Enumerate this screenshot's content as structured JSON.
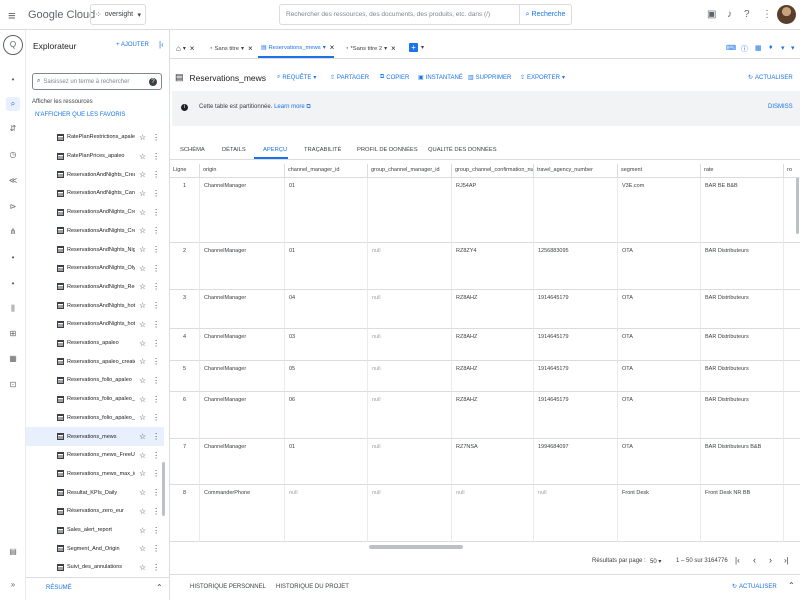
{
  "topbar": {
    "logo_google": "Google",
    "logo_cloud": "Cloud",
    "project": "oversight",
    "search_placeholder": "Rechercher des ressources, des documents, des produits, etc. dans (/)",
    "search_button": "Recherche"
  },
  "explorer": {
    "title": "Explorateur",
    "add_label": "+ AJOUTER",
    "search_placeholder": "Saisissez un terme à rechercher",
    "show_resources": "Afficher les ressources",
    "show_starred": "N'AFFICHER QUE LES FAVORIS",
    "items": [
      "RatePlanRestrictions_apaleo",
      "RatePlanPrices_apaleo",
      "ReservationAndNights_Creat...",
      "ReservationAndNights_Can...",
      "ReservationsAndNights_Crea...",
      "ReservationsAndNights_Crea...",
      "ReservationsAndNights_Night...",
      "ReservationsAndNights_Oly...",
      "ReservationsAndNights_Reg...",
      "ReservationsAndNights_hote...",
      "ReservationsAndNights_hote...",
      "Reservations_apaleo",
      "Reservations_apaleo_created...",
      "Reservations_folio_apaleo",
      "Reservations_folio_apaleo_A...",
      "Reservations_folio_apaleo_p...",
      "Reservations_mews",
      "Reservations_mews_FreeUpg...",
      "Reservations_mews_max_ins...",
      "Resultat_KPIs_Daily",
      "Réservations_zero_eur",
      "Sales_alert_report",
      "Segment_And_Origin",
      "Suivi_des_annulations"
    ],
    "selected_index": 16,
    "footer_label": "RÉSUMÉ"
  },
  "tabs": [
    {
      "label": ""
    },
    {
      "label": "Sans titre"
    },
    {
      "label": "Reservations_mews"
    },
    {
      "label": "*Sans titre 2"
    }
  ],
  "toolbar": {
    "title": "Reservations_mews",
    "query": "REQUÊTE",
    "share": "PARTAGER",
    "copy": "COPIER",
    "snapshot": "INSTANTANÉ",
    "delete": "SUPPRIMER",
    "export": "EXPORTER",
    "refresh": "ACTUALISER"
  },
  "info": {
    "text": "Cette table est partitionnée.",
    "link": "Learn more",
    "dismiss": "DISMISS"
  },
  "subtabs": [
    "SCHÉMA",
    "DÉTAILS",
    "APERÇU",
    "TRAÇABILITÉ",
    "PROFIL DE DONNÉES",
    "QUALITÉ DES DONNÉES"
  ],
  "grid": {
    "columns": [
      "Ligne",
      "origin",
      "channel_manager_id",
      "group_channel_manager_id",
      "group_channel_confirmation_numb",
      "travel_agency_number",
      "segment",
      "rate",
      "ro"
    ],
    "rows": [
      [
        "1",
        "ChannelManager",
        "01",
        "",
        "RJ54AP",
        "",
        "V3E.com",
        "BAR BE B&B",
        ""
      ],
      [
        "2",
        "ChannelManager",
        "01",
        "null",
        "RZ8ZY4",
        "1256883095",
        "OTA",
        "BAR Distributeurs",
        ""
      ],
      [
        "3",
        "ChannelManager",
        "04",
        "null",
        "RZ8AHZ",
        "1914645179",
        "OTA",
        "BAR Distributeurs",
        ""
      ],
      [
        "4",
        "ChannelManager",
        "03",
        "null",
        "RZ8AHZ",
        "1914645179",
        "OTA",
        "BAR Distributeurs",
        ""
      ],
      [
        "5",
        "ChannelManager",
        "05",
        "null",
        "RZ8AHZ",
        "1914645179",
        "OTA",
        "BAR Distributeurs",
        ""
      ],
      [
        "6",
        "ChannelManager",
        "06",
        "null",
        "RZ8AHZ",
        "1914645179",
        "OTA",
        "BAR Distributeurs",
        ""
      ],
      [
        "7",
        "ChannelManager",
        "01",
        "null",
        "RZ7NSA",
        "1994684097",
        "OTA",
        "BAR Distributeurs B&B",
        ""
      ],
      [
        "8",
        "CommanderPhone",
        "null",
        "null",
        "null",
        "null",
        "Front Desk",
        "Front Desk NR BB",
        ""
      ]
    ]
  },
  "pager": {
    "label": "Résultats par page :",
    "per_page": "50",
    "range": "1 – 50 sur 3164776"
  },
  "bottom": {
    "personal_history": "HISTORIQUE PERSONNEL",
    "project_history": "HISTORIQUE DU PROJET",
    "refresh": "ACTUALISER"
  }
}
